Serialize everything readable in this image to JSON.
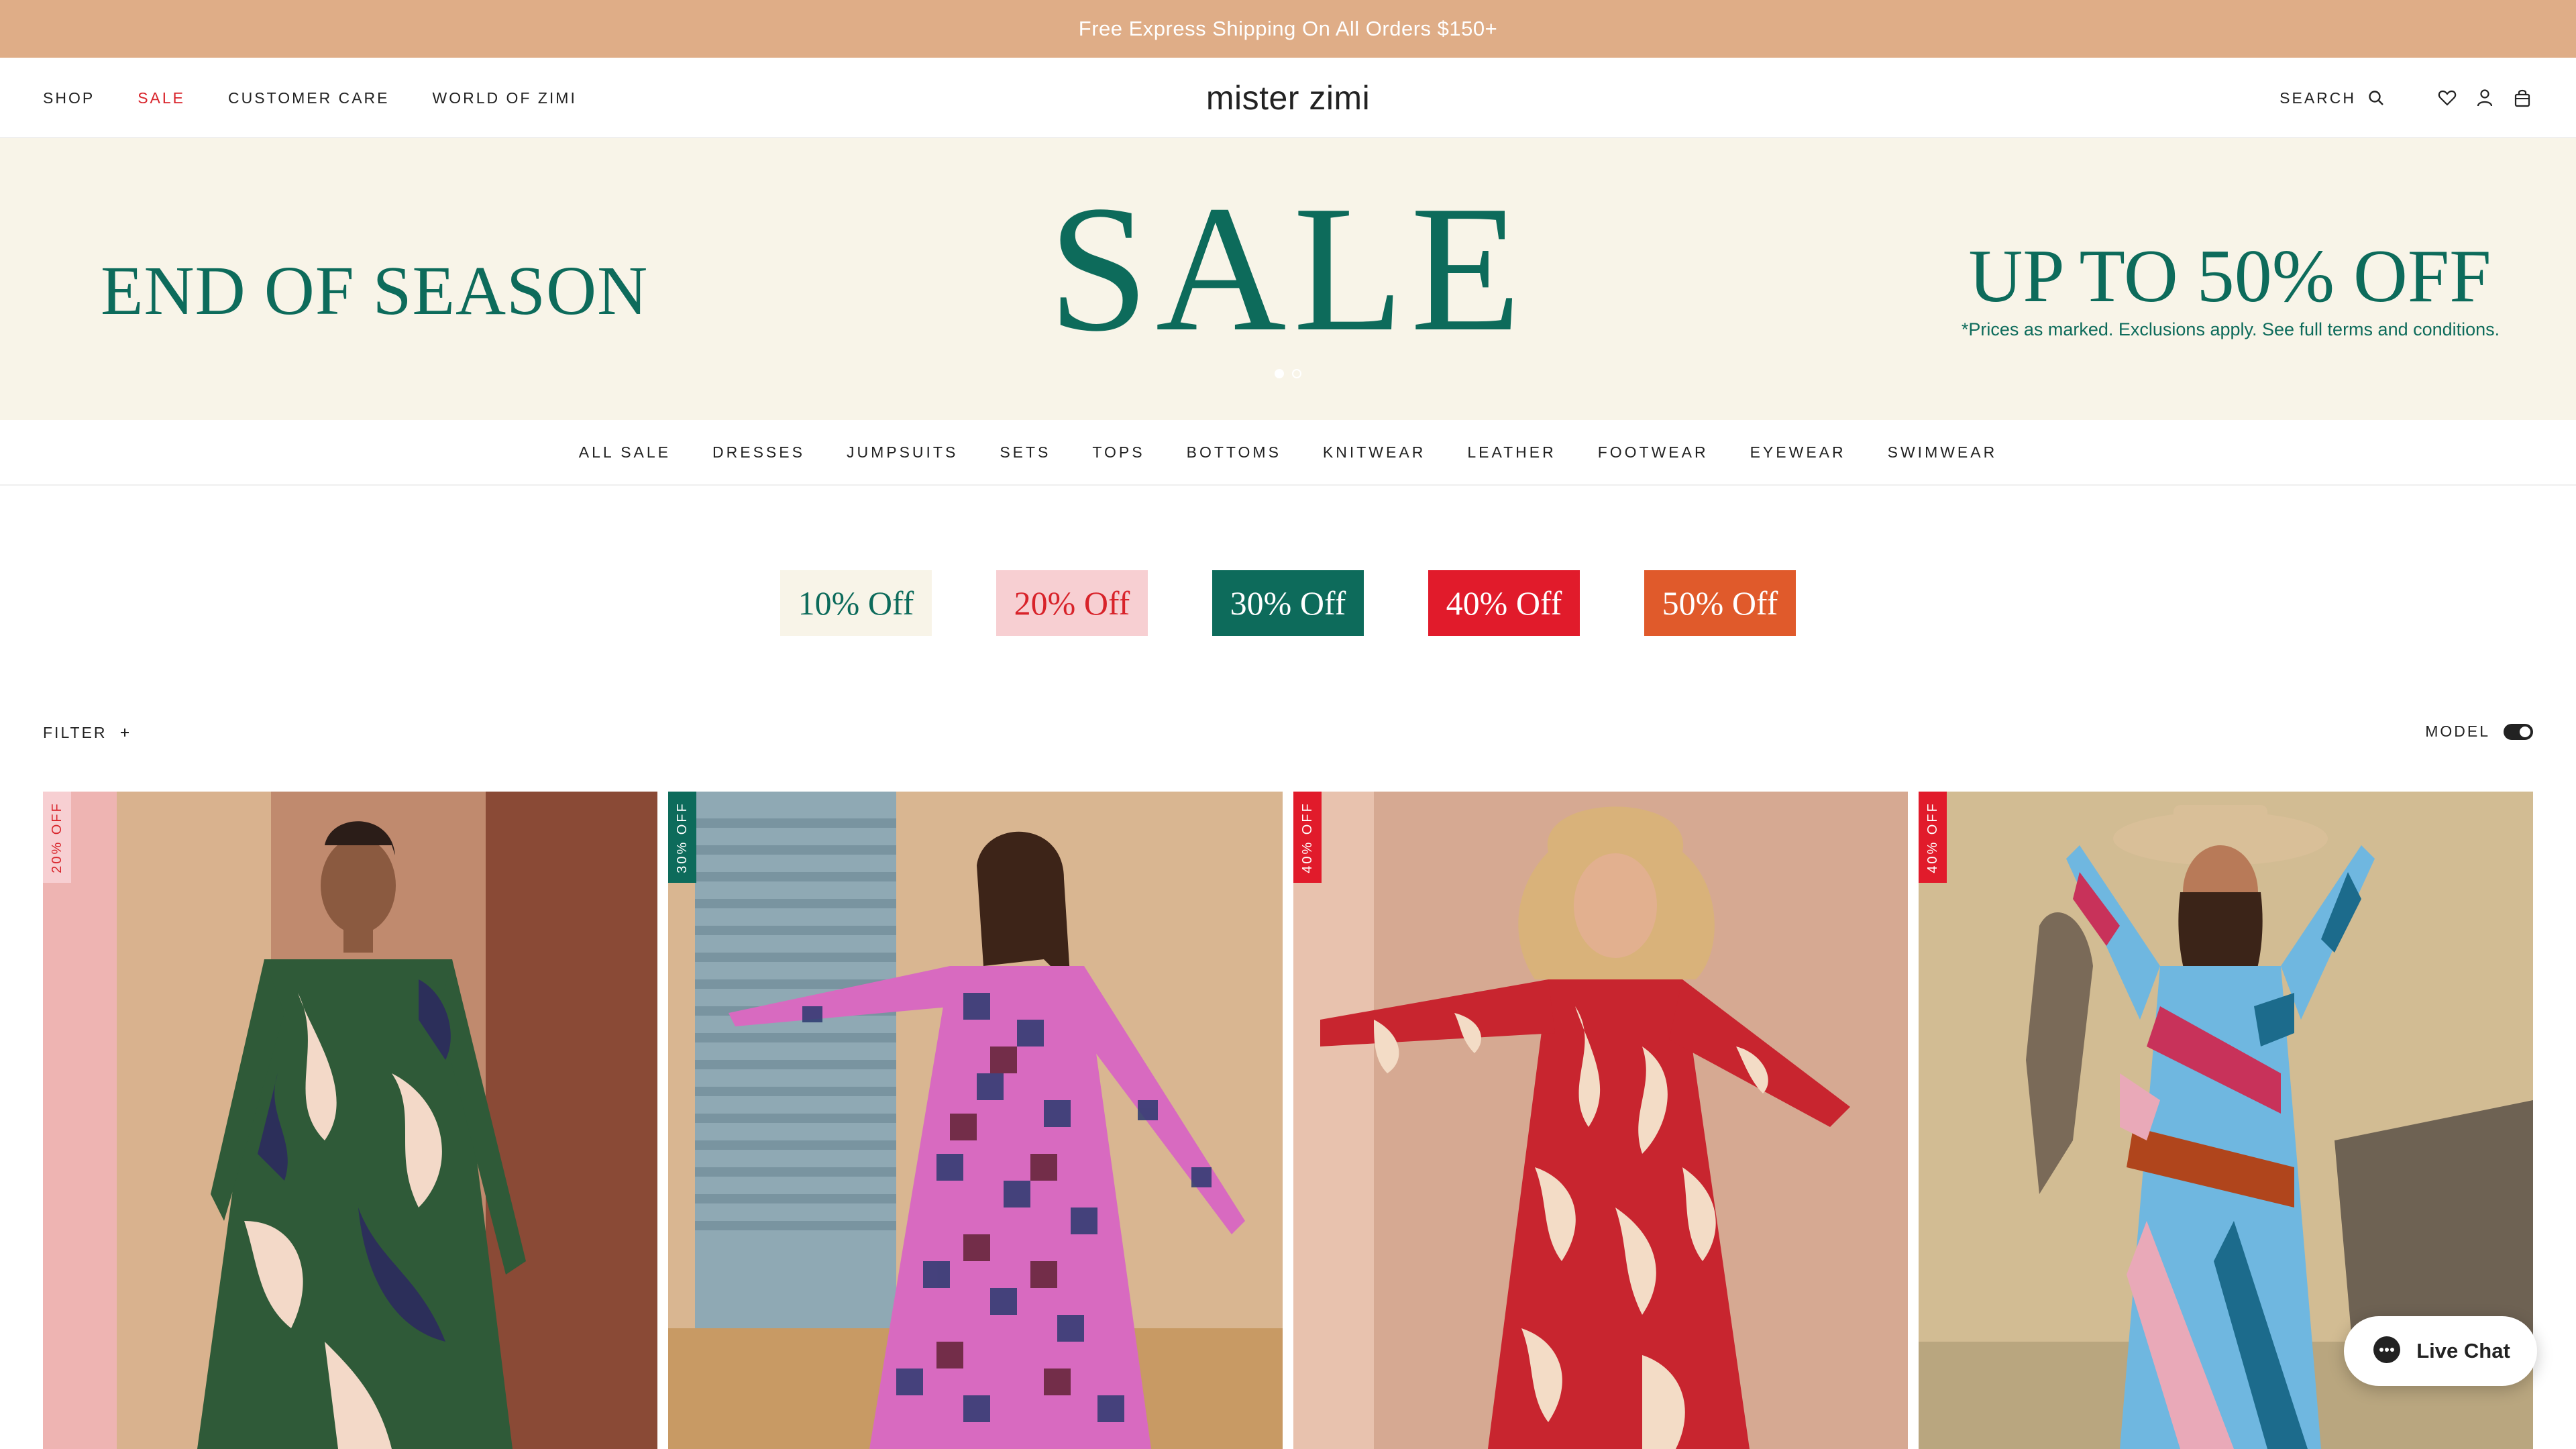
{
  "announcement": {
    "text": "Free Express Shipping On All Orders $150+"
  },
  "header": {
    "nav": [
      "SHOP",
      "SALE",
      "CUSTOMER CARE",
      "WORLD OF ZIMI"
    ],
    "logo": "mister zimi",
    "search_label": "SEARCH",
    "icons": [
      "search-icon",
      "heart-icon",
      "account-icon",
      "bag-icon"
    ]
  },
  "hero": {
    "left_text": "END OF SEASON",
    "center_text": "SALE",
    "right_text": "UP TO 50% OFF",
    "terms": "*Prices as marked. Exclusions apply. See full terms and conditions.",
    "slides": 2,
    "active_slide": 1,
    "color": "#0d6b5b",
    "background": "#f8f4e8"
  },
  "categories": [
    "ALL SALE",
    "DRESSES",
    "JUMPSUITS",
    "SETS",
    "TOPS",
    "BOTTOMS",
    "KNITWEAR",
    "LEATHER",
    "FOOTWEAR",
    "EYEWEAR",
    "SWIMWEAR"
  ],
  "discount_pills": [
    {
      "label": "10% Off",
      "bg": "#f8f4e8",
      "fg": "#0d6b5b"
    },
    {
      "label": "20% Off",
      "bg": "#f7cfd2",
      "fg": "#d8232a"
    },
    {
      "label": "30% Off",
      "bg": "#0d6b5b",
      "fg": "#ffffff"
    },
    {
      "label": "40% Off",
      "bg": "#e11b2b",
      "fg": "#ffffff"
    },
    {
      "label": "50% Off",
      "bg": "#e05a2b",
      "fg": "#ffffff"
    }
  ],
  "filter": {
    "label": "FILTER",
    "icon": "plus-icon"
  },
  "model_toggle": {
    "label": "MODEL",
    "on": true
  },
  "products": [
    {
      "badge": "20% OFF",
      "badge_bg": "#f7cfd2",
      "badge_fg": "#d8232a"
    },
    {
      "badge": "30% OFF",
      "badge_bg": "#0d6b5b",
      "badge_fg": "#ffffff"
    },
    {
      "badge": "40% OFF",
      "badge_bg": "#e11b2b",
      "badge_fg": "#ffffff"
    },
    {
      "badge": "40% OFF",
      "badge_bg": "#e11b2b",
      "badge_fg": "#ffffff"
    }
  ],
  "live_chat": {
    "label": "Live Chat",
    "icon": "chat-bubble-icon"
  }
}
